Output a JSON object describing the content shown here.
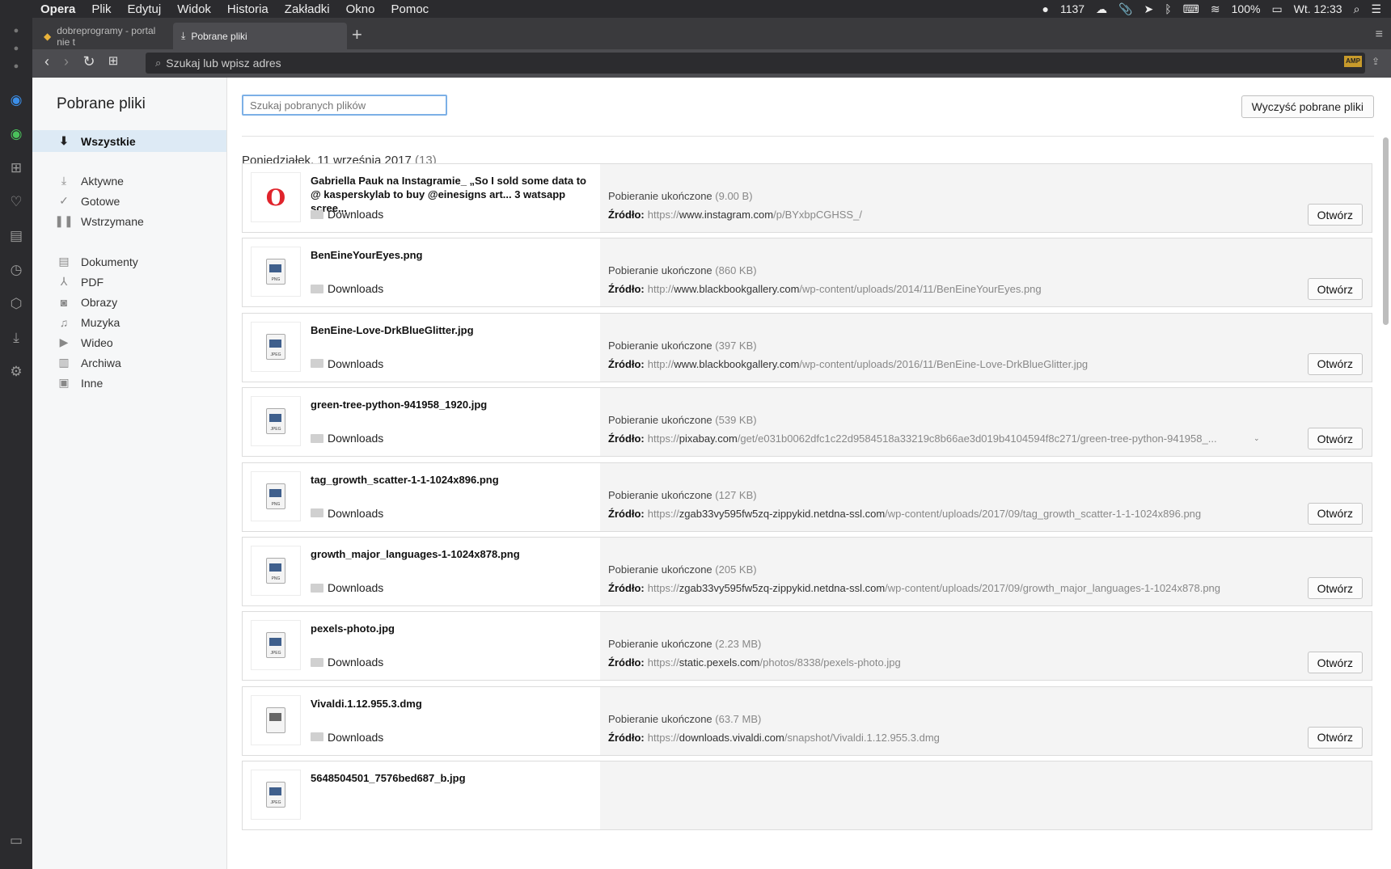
{
  "menubar": {
    "apple": "",
    "items": [
      "Opera",
      "Plik",
      "Edytuj",
      "Widok",
      "Historia",
      "Zakładki",
      "Okno",
      "Pomoc"
    ],
    "status_count": "1137",
    "battery": "100%",
    "clock": "Wt. 12:33"
  },
  "tabs": [
    {
      "title": "dobreprogramy - portal nie t"
    },
    {
      "title": "Pobrane pliki"
    }
  ],
  "addressbar": {
    "placeholder": "Szukaj lub wpisz adres",
    "amp": "AMP"
  },
  "sidebar": {
    "title": "Pobrane pliki",
    "categories": [
      {
        "label": "Wszystkie",
        "icon": "download-arrow-icon"
      },
      {
        "label": "Aktywne",
        "icon": "active-download-icon"
      },
      {
        "label": "Gotowe",
        "icon": "checkmark-icon"
      },
      {
        "label": "Wstrzymane",
        "icon": "pause-icon"
      },
      {
        "label": "Dokumenty",
        "icon": "document-icon"
      },
      {
        "label": "PDF",
        "icon": "pdf-icon"
      },
      {
        "label": "Obrazy",
        "icon": "camera-icon"
      },
      {
        "label": "Muzyka",
        "icon": "music-icon"
      },
      {
        "label": "Wideo",
        "icon": "video-icon"
      },
      {
        "label": "Archiwa",
        "icon": "archive-icon"
      },
      {
        "label": "Inne",
        "icon": "terminal-icon"
      }
    ]
  },
  "search": {
    "placeholder": "Szukaj pobranych plików"
  },
  "clear_button": "Wyczyść pobrane pliki",
  "group": {
    "date": "Poniedziałek, 11 września 2017",
    "count": "(13)"
  },
  "labels": {
    "status": "Pobieranie ukończone",
    "source": "Źródło:",
    "open": "Otwórz",
    "folder": "Downloads"
  },
  "downloads": [
    {
      "name": "Gabriella Pauk na Instagramie_ „So I sold some data to @ kasperskylab to buy @einesigns art... 3 watsapp scree...",
      "type": "opera",
      "size": "(9.00 B)",
      "scheme": "https://",
      "domain": "www.instagram.com",
      "path": "/p/BYxbpCGHSS_/"
    },
    {
      "name": "BenEineYourEyes.png",
      "type": "PNG",
      "size": "(860 KB)",
      "scheme": "http://",
      "domain": "www.blackbookgallery.com",
      "path": "/wp-content/uploads/2014/11/BenEineYourEyes.png"
    },
    {
      "name": "BenEine-Love-DrkBlueGlitter.jpg",
      "type": "JPEG",
      "size": "(397 KB)",
      "scheme": "http://",
      "domain": "www.blackbookgallery.com",
      "path": "/wp-content/uploads/2016/11/BenEine-Love-DrkBlueGlitter.jpg"
    },
    {
      "name": "green-tree-python-941958_1920.jpg",
      "type": "JPEG",
      "size": "(539 KB)",
      "scheme": "https://",
      "domain": "pixabay.com",
      "path": "/get/e031b0062dfc1c22d9584518a33219c8b66ae3d019b4104594f8c271/green-tree-python-941958_...",
      "expand": "⌄"
    },
    {
      "name": "tag_growth_scatter-1-1-1024x896.png",
      "type": "PNG",
      "size": "(127 KB)",
      "scheme": "https://",
      "domain": "zgab33vy595fw5zq-zippykid.netdna-ssl.com",
      "path": "/wp-content/uploads/2017/09/tag_growth_scatter-1-1-1024x896.png"
    },
    {
      "name": "growth_major_languages-1-1024x878.png",
      "type": "PNG",
      "size": "(205 KB)",
      "scheme": "https://",
      "domain": "zgab33vy595fw5zq-zippykid.netdna-ssl.com",
      "path": "/wp-content/uploads/2017/09/growth_major_languages-1-1024x878.png"
    },
    {
      "name": "pexels-photo.jpg",
      "type": "JPEG",
      "size": "(2.23 MB)",
      "scheme": "https://",
      "domain": "static.pexels.com",
      "path": "/photos/8338/pexels-photo.jpg"
    },
    {
      "name": "Vivaldi.1.12.955.3.dmg",
      "type": "dmg",
      "size": "(63.7 MB)",
      "scheme": "https://",
      "domain": "downloads.vivaldi.com",
      "path": "/snapshot/Vivaldi.1.12.955.3.dmg"
    },
    {
      "name": "5648504501_7576bed687_b.jpg",
      "type": "JPEG",
      "size": "",
      "scheme": "",
      "domain": "",
      "path": ""
    }
  ]
}
